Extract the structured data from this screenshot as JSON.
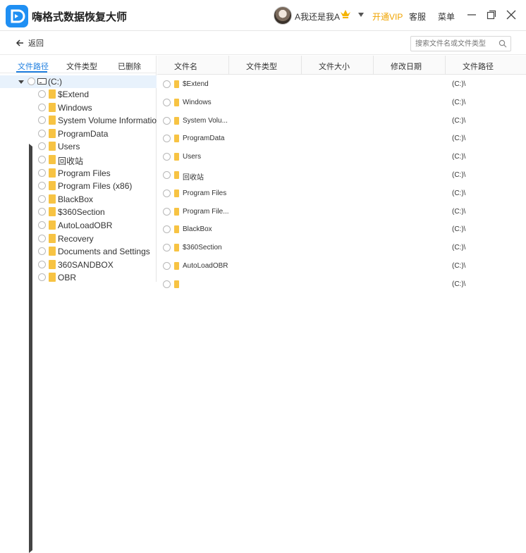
{
  "app": {
    "title": "嗨格式数据恢复大师",
    "username": "A我还是我A",
    "vip_label": "开通VIP",
    "service_label": "客服",
    "menu_label": "菜单"
  },
  "toolbar": {
    "back_label": "返回",
    "search_placeholder": "搜索文件名或文件类型"
  },
  "left_tabs": [
    "文件路径",
    "文件类型",
    "已删除"
  ],
  "active_tab": "文件路径",
  "tree": {
    "root": "(C:)",
    "items": [
      {
        "label": "$Extend",
        "expandable": true
      },
      {
        "label": "Windows",
        "expandable": true
      },
      {
        "label": "System Volume Informatio",
        "expandable": true
      },
      {
        "label": "ProgramData",
        "expandable": true
      },
      {
        "label": "Users",
        "expandable": true
      },
      {
        "label": "回收站",
        "expandable": true
      },
      {
        "label": "Program Files",
        "expandable": true
      },
      {
        "label": "Program Files (x86)",
        "expandable": true
      },
      {
        "label": "BlackBox",
        "expandable": true
      },
      {
        "label": "$360Section",
        "expandable": false
      },
      {
        "label": "AutoLoadOBR",
        "expandable": false
      },
      {
        "label": "Recovery",
        "expandable": true
      },
      {
        "label": "Documents and Settings",
        "expandable": false
      },
      {
        "label": "360SANDBOX",
        "expandable": false
      },
      {
        "label": "OBR",
        "expandable": true
      }
    ]
  },
  "table": {
    "columns": [
      "文件名",
      "文件类型",
      "文件大小",
      "修改日期",
      "文件路径"
    ],
    "rows": [
      {
        "name": "$Extend",
        "path": "(C:)\\"
      },
      {
        "name": "Windows",
        "path": "(C:)\\"
      },
      {
        "name": "System Volu...",
        "path": "(C:)\\"
      },
      {
        "name": "ProgramData",
        "path": "(C:)\\"
      },
      {
        "name": "Users",
        "path": "(C:)\\"
      },
      {
        "name": "回收站",
        "path": "(C:)\\"
      },
      {
        "name": "Program Files",
        "path": "(C:)\\"
      },
      {
        "name": "Program File...",
        "path": "(C:)\\"
      },
      {
        "name": "BlackBox",
        "path": "(C:)\\"
      },
      {
        "name": "$360Section",
        "path": "(C:)\\"
      },
      {
        "name": "AutoLoadOBR",
        "path": "(C:)\\"
      },
      {
        "name": "",
        "path": "(C:)\\"
      }
    ]
  },
  "colors": {
    "accent": "#1f7fe0",
    "vip": "#f0a400",
    "folder": "#f7c343"
  }
}
